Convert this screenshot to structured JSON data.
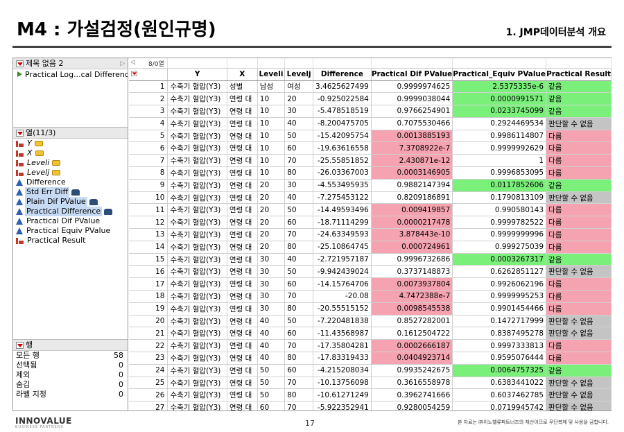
{
  "slide": {
    "title": "M4 : 가설검정(원인규명)",
    "subtitle": "1. JMP데이터분석 개요",
    "page_number": "17",
    "logo": "INNOVALUE",
    "logo_sub": "BUSINESS PARTNERS",
    "copyright": "본 자료는 ㈜이노밸류파트너즈의 재산이므로 무단복제 및 사용을 금합니다."
  },
  "jmp": {
    "table_panel": {
      "title": "제목 없음 2",
      "scripts": [
        "Practical Log...cal Difference"
      ]
    },
    "columns_panel": {
      "title": "열(11/3)",
      "items": [
        {
          "label": "Y",
          "type": "nominal",
          "italic": true,
          "role": true,
          "selected": false
        },
        {
          "label": "X",
          "type": "nominal",
          "italic": true,
          "role": true,
          "selected": false
        },
        {
          "label": "Leveli",
          "type": "nominal",
          "italic": true,
          "role": true,
          "selected": false
        },
        {
          "label": "Levelj",
          "type": "nominal",
          "italic": true,
          "role": true,
          "selected": false
        },
        {
          "label": "Difference",
          "type": "continuous",
          "italic": false,
          "role": false,
          "selected": false
        },
        {
          "label": "Std Err Diff",
          "type": "continuous",
          "italic": false,
          "role": false,
          "locked": true,
          "selected": true
        },
        {
          "label": "Plain Dif PValue",
          "type": "continuous",
          "italic": false,
          "role": false,
          "locked": true,
          "selected": true
        },
        {
          "label": "Practical Difference",
          "type": "continuous",
          "italic": false,
          "role": false,
          "locked": true,
          "selected": true
        },
        {
          "label": "Practical Dif PValue",
          "type": "continuous",
          "italic": false,
          "role": false,
          "selected": false
        },
        {
          "label": "Practical Equiv PValue",
          "type": "continuous",
          "italic": false,
          "role": false,
          "selected": false
        },
        {
          "label": "Practical Result",
          "type": "nominal",
          "italic": false,
          "role": false,
          "selected": false
        }
      ]
    },
    "rows_panel": {
      "title": "행",
      "stats": [
        {
          "label": "모든 행",
          "value": "58"
        },
        {
          "label": "선택됨",
          "value": "0"
        },
        {
          "label": "제외",
          "value": "0"
        },
        {
          "label": "숨김",
          "value": "0"
        },
        {
          "label": "라벨 지정",
          "value": "0"
        }
      ]
    },
    "grid": {
      "selection_count": "8/0열",
      "headers": [
        "Y",
        "X",
        "Leveli",
        "Levelj",
        "Difference",
        "Practical Dif PValue",
        "Practical_Equiv PValue",
        "Practical Result"
      ],
      "rows": [
        {
          "n": "1",
          "y": "수축기 혈압(Y3)",
          "x": "성별",
          "li": "남성",
          "lj": "여성",
          "diff": "3.4625627499",
          "pdp": "0.9999974625",
          "pep": "2.5375335e-6",
          "res": "같음",
          "pdp_c": "",
          "pep_c": "green",
          "res_c": "green"
        },
        {
          "n": "2",
          "y": "수축기 혈압(Y3)",
          "x": "연령 대",
          "li": "10",
          "lj": "20",
          "diff": "-0.925022584",
          "pdp": "0.9999038044",
          "pep": "0.0000991571",
          "res": "같음",
          "pdp_c": "",
          "pep_c": "green",
          "res_c": "green"
        },
        {
          "n": "3",
          "y": "수축기 혈압(Y3)",
          "x": "연령 대",
          "li": "10",
          "lj": "30",
          "diff": "-5.478518519",
          "pdp": "0.9766254901",
          "pep": "0.0233745099",
          "res": "같음",
          "pdp_c": "",
          "pep_c": "green",
          "res_c": "green"
        },
        {
          "n": "4",
          "y": "수축기 혈압(Y3)",
          "x": "연령 대",
          "li": "10",
          "lj": "40",
          "diff": "-8.200475705",
          "pdp": "0.7075530466",
          "pep": "0.2924469534",
          "res": "판단할 수 없음",
          "pdp_c": "",
          "pep_c": "",
          "res_c": "gray"
        },
        {
          "n": "5",
          "y": "수축기 혈압(Y3)",
          "x": "연령 대",
          "li": "10",
          "lj": "50",
          "diff": "-15.42095754",
          "pdp": "0.0013885193",
          "pep": "0.9986114807",
          "res": "다름",
          "pdp_c": "pink",
          "pep_c": "",
          "res_c": "pink"
        },
        {
          "n": "6",
          "y": "수축기 혈압(Y3)",
          "x": "연령 대",
          "li": "10",
          "lj": "60",
          "diff": "-19.63616558",
          "pdp": "7.3708922e-7",
          "pep": "0.9999992629",
          "res": "다름",
          "pdp_c": "pink",
          "pep_c": "",
          "res_c": "pink"
        },
        {
          "n": "7",
          "y": "수축기 혈압(Y3)",
          "x": "연령 대",
          "li": "10",
          "lj": "70",
          "diff": "-25.55851852",
          "pdp": "2.430871e-12",
          "pep": "1",
          "res": "다름",
          "pdp_c": "pink",
          "pep_c": "",
          "res_c": "pink"
        },
        {
          "n": "8",
          "y": "수축기 혈압(Y3)",
          "x": "연령 대",
          "li": "10",
          "lj": "80",
          "diff": "-26.03367003",
          "pdp": "0.0003146905",
          "pep": "0.9996853095",
          "res": "다름",
          "pdp_c": "pink",
          "pep_c": "",
          "res_c": "pink"
        },
        {
          "n": "9",
          "y": "수축기 혈압(Y3)",
          "x": "연령 대",
          "li": "20",
          "lj": "30",
          "diff": "-4.553495935",
          "pdp": "0.9882147394",
          "pep": "0.0117852606",
          "res": "같음",
          "pdp_c": "",
          "pep_c": "green",
          "res_c": "green"
        },
        {
          "n": "10",
          "y": "수축기 혈압(Y3)",
          "x": "연령 대",
          "li": "20",
          "lj": "40",
          "diff": "-7.275453122",
          "pdp": "0.8209186891",
          "pep": "0.1790813109",
          "res": "판단할 수 없음",
          "pdp_c": "",
          "pep_c": "",
          "res_c": "gray"
        },
        {
          "n": "11",
          "y": "수축기 혈압(Y3)",
          "x": "연령 대",
          "li": "20",
          "lj": "50",
          "diff": "-14.49593496",
          "pdp": "0.009419857",
          "pep": "0.990580143",
          "res": "다름",
          "pdp_c": "pink",
          "pep_c": "",
          "res_c": "pink"
        },
        {
          "n": "12",
          "y": "수축기 혈압(Y3)",
          "x": "연령 대",
          "li": "20",
          "lj": "60",
          "diff": "-18.71114299",
          "pdp": "0.0000217478",
          "pep": "0.9999782522",
          "res": "다름",
          "pdp_c": "pink",
          "pep_c": "",
          "res_c": "pink"
        },
        {
          "n": "13",
          "y": "수축기 혈압(Y3)",
          "x": "연령 대",
          "li": "20",
          "lj": "70",
          "diff": "-24.63349593",
          "pdp": "3.878443e-10",
          "pep": "0.9999999996",
          "res": "다름",
          "pdp_c": "pink",
          "pep_c": "",
          "res_c": "pink"
        },
        {
          "n": "14",
          "y": "수축기 혈압(Y3)",
          "x": "연령 대",
          "li": "20",
          "lj": "80",
          "diff": "-25.10864745",
          "pdp": "0.000724961",
          "pep": "0.999275039",
          "res": "다름",
          "pdp_c": "pink",
          "pep_c": "",
          "res_c": "pink"
        },
        {
          "n": "15",
          "y": "수축기 혈압(Y3)",
          "x": "연령 대",
          "li": "30",
          "lj": "40",
          "diff": "-2.721957187",
          "pdp": "0.9996732686",
          "pep": "0.0003267317",
          "res": "같음",
          "pdp_c": "",
          "pep_c": "green",
          "res_c": "green"
        },
        {
          "n": "16",
          "y": "수축기 혈압(Y3)",
          "x": "연령 대",
          "li": "30",
          "lj": "50",
          "diff": "-9.942439024",
          "pdp": "0.3737148873",
          "pep": "0.6262851127",
          "res": "판단할 수 없음",
          "pdp_c": "",
          "pep_c": "",
          "res_c": "gray"
        },
        {
          "n": "17",
          "y": "수축기 혈압(Y3)",
          "x": "연령 대",
          "li": "30",
          "lj": "60",
          "diff": "-14.15764706",
          "pdp": "0.0073937804",
          "pep": "0.9926062196",
          "res": "다름",
          "pdp_c": "pink",
          "pep_c": "",
          "res_c": "pink"
        },
        {
          "n": "18",
          "y": "수축기 혈압(Y3)",
          "x": "연령 대",
          "li": "30",
          "lj": "70",
          "diff": "-20.08",
          "pdp": "4.7472388e-7",
          "pep": "0.9999995253",
          "res": "다름",
          "pdp_c": "pink",
          "pep_c": "",
          "res_c": "pink"
        },
        {
          "n": "19",
          "y": "수축기 혈압(Y3)",
          "x": "연령 대",
          "li": "30",
          "lj": "80",
          "diff": "-20.55515152",
          "pdp": "0.0098545538",
          "pep": "0.9901454466",
          "res": "다름",
          "pdp_c": "pink",
          "pep_c": "",
          "res_c": "pink"
        },
        {
          "n": "20",
          "y": "수축기 혈압(Y3)",
          "x": "연령 대",
          "li": "40",
          "lj": "50",
          "diff": "-7.220481838",
          "pdp": "0.8527282001",
          "pep": "0.1472717999",
          "res": "판단할 수 없음",
          "pdp_c": "",
          "pep_c": "",
          "res_c": "gray"
        },
        {
          "n": "21",
          "y": "수축기 혈압(Y3)",
          "x": "연령 대",
          "li": "40",
          "lj": "60",
          "diff": "-11.43568987",
          "pdp": "0.1612504722",
          "pep": "0.8387495278",
          "res": "판단할 수 없음",
          "pdp_c": "",
          "pep_c": "",
          "res_c": "gray"
        },
        {
          "n": "22",
          "y": "수축기 혈압(Y3)",
          "x": "연령 대",
          "li": "40",
          "lj": "70",
          "diff": "-17.35804281",
          "pdp": "0.0002666187",
          "pep": "0.9997333813",
          "res": "다름",
          "pdp_c": "pink",
          "pep_c": "",
          "res_c": "pink"
        },
        {
          "n": "23",
          "y": "수축기 혈압(Y3)",
          "x": "연령 대",
          "li": "40",
          "lj": "80",
          "diff": "-17.83319433",
          "pdp": "0.0404923714",
          "pep": "0.9595076444",
          "res": "다름",
          "pdp_c": "pink",
          "pep_c": "",
          "res_c": "pink"
        },
        {
          "n": "24",
          "y": "수축기 혈압(Y3)",
          "x": "연령 대",
          "li": "50",
          "lj": "60",
          "diff": "-4.215208034",
          "pdp": "0.9935242675",
          "pep": "0.0064757325",
          "res": "같음",
          "pdp_c": "",
          "pep_c": "green",
          "res_c": "green"
        },
        {
          "n": "25",
          "y": "수축기 혈압(Y3)",
          "x": "연령 대",
          "li": "50",
          "lj": "70",
          "diff": "-10.13756098",
          "pdp": "0.3616558978",
          "pep": "0.6383441022",
          "res": "판단할 수 없음",
          "pdp_c": "",
          "pep_c": "",
          "res_c": "gray"
        },
        {
          "n": "26",
          "y": "수축기 혈압(Y3)",
          "x": "연령 대",
          "li": "50",
          "lj": "80",
          "diff": "-10.61271249",
          "pdp": "0.3962741666",
          "pep": "0.6037462785",
          "res": "판단할 수 없음",
          "pdp_c": "",
          "pep_c": "",
          "res_c": "gray"
        },
        {
          "n": "27",
          "y": "수축기 혈압(Y3)",
          "x": "연령 대",
          "li": "60",
          "lj": "70",
          "diff": "-5.922352941",
          "pdp": "0.9280054259",
          "pep": "0.0719945742",
          "res": "판단할 수 없음",
          "pdp_c": "",
          "pep_c": "",
          "res_c": "gray"
        }
      ]
    }
  },
  "colors": {
    "equal": "#7af07a",
    "different": "#f5a3b0",
    "undecided": "#c4c4c4"
  }
}
